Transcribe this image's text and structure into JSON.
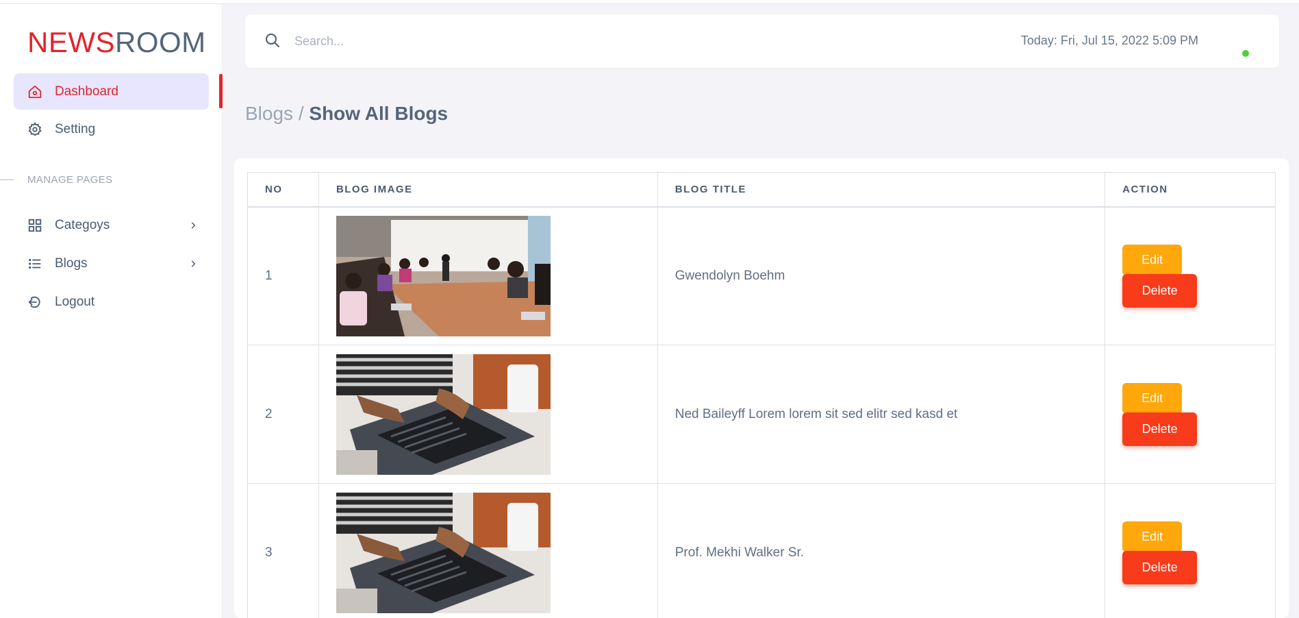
{
  "brand": {
    "part1": "NEWS",
    "part2": "ROOM",
    "color_primary": "#e3232c",
    "color_secondary": "#55657a"
  },
  "sidebar": {
    "items": [
      {
        "label": "Dashboard",
        "icon": "home-icon",
        "active": true
      },
      {
        "label": "Setting",
        "icon": "gear-icon",
        "active": false
      }
    ],
    "section_label": "MANAGE PAGES",
    "manage_items": [
      {
        "label": "Categoys",
        "icon": "grid-icon",
        "has_submenu": true
      },
      {
        "label": "Blogs",
        "icon": "list-icon",
        "has_submenu": true
      },
      {
        "label": "Logout",
        "icon": "logout-icon",
        "has_submenu": false
      }
    ]
  },
  "header": {
    "search_placeholder": "Search...",
    "today": "Today: Fri, Jul 15, 2022 5:09 PM",
    "status_color": "#4cd137"
  },
  "breadcrumb": {
    "parent": "Blogs",
    "separator": " / ",
    "current": "Show All Blogs"
  },
  "table": {
    "columns": [
      "NO",
      "BLOG IMAGE",
      "BLOG TITLE",
      "ACTION"
    ],
    "rows": [
      {
        "no": "1",
        "image": "meeting-room-photo",
        "title": "Gwendolyn Boehm"
      },
      {
        "no": "2",
        "image": "laptop-typing-photo",
        "title": "Ned Baileyff Lorem lorem sit sed elitr sed kasd et"
      },
      {
        "no": "3",
        "image": "laptop-typing-photo",
        "title": "Prof. Mekhi Walker Sr."
      }
    ],
    "edit_label": "Edit",
    "delete_label": "Delete",
    "edit_color": "#ffa70b",
    "delete_color": "#f73b1b"
  }
}
